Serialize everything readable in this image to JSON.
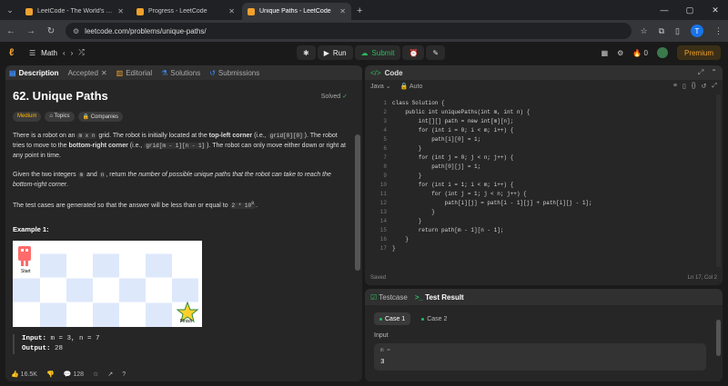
{
  "browser": {
    "tabs": [
      {
        "title": "LeetCode - The World's Leadin",
        "active": false
      },
      {
        "title": "Progress - LeetCode",
        "active": false
      },
      {
        "title": "Unique Paths - LeetCode",
        "active": true
      }
    ],
    "url": "leetcode.com/problems/unique-paths/",
    "profile_initial": "T"
  },
  "header": {
    "problem_list": "Math",
    "run_label": "Run",
    "submit_label": "Submit",
    "streak": "0",
    "premium_label": "Premium"
  },
  "left_tabs": [
    {
      "label": "Description"
    },
    {
      "label": "Accepted"
    },
    {
      "label": "Editorial"
    },
    {
      "label": "Solutions"
    },
    {
      "label": "Submissions"
    }
  ],
  "problem": {
    "title": "62. Unique Paths",
    "status": "Solved",
    "difficulty": "Medium",
    "topics_label": "Topics",
    "companies_label": "Companies",
    "p1_a": "There is a robot on an ",
    "p1_code1": "m x n",
    "p1_b": " grid. The robot is initially located at the ",
    "p1_bold1": "top-left corner",
    "p1_c": " (i.e., ",
    "p1_code2": "grid[0][0]",
    "p1_d": "). The robot tries to move to the ",
    "p1_bold2": "bottom-right corner",
    "p1_e": " (i.e., ",
    "p1_code3": "grid[m - 1][n - 1]",
    "p1_f": "). The robot can only move either down or right at any point in time.",
    "p2_a": "Given the two integers ",
    "p2_code1": "m",
    "p2_b": " and ",
    "p2_code2": "n",
    "p2_c": ", return ",
    "p2_em": "the number of possible unique paths that the robot can take to reach the bottom-right corner",
    "p2_d": ".",
    "p3_a": "The test cases are generated so that the answer will be less than or equal to ",
    "p3_code": "2 * 10",
    "p3_sup": "9",
    "p3_b": ".",
    "example_title": "Example 1:",
    "grid_start": "Start",
    "grid_finish": "Finish",
    "input_label": "Input:",
    "input_value": "m = 3, n = 7",
    "output_label": "Output:",
    "output_value": "28",
    "likes": "16.5K",
    "comments": "128"
  },
  "code_panel": {
    "title": "Code",
    "language": "Java",
    "mode": "Auto",
    "lines": [
      "class Solution {",
      "    public int uniquePaths(int m, int n) {",
      "        int[][] path = new int[m][n];",
      "        for (int i = 0; i < m; i++) {",
      "            path[i][0] = 1;",
      "        }",
      "        for (int j = 0; j < n; j++) {",
      "            path[0][j] = 1;",
      "        }",
      "        for (int i = 1; i < m; i++) {",
      "            for (int j = 1; j < n; j++) {",
      "                path[i][j] = path[i - 1][j] + path[i][j - 1];",
      "            }",
      "        }",
      "        return path[m - 1][n - 1];",
      "    }",
      "}"
    ],
    "saved": "Saved",
    "cursor": "Ln 17, Col 2"
  },
  "result_panel": {
    "testcase_label": "Testcase",
    "result_label": "Test Result",
    "cases": [
      "Case 1",
      "Case 2"
    ],
    "input_label": "Input",
    "var_name": "m =",
    "var_value": "3"
  }
}
